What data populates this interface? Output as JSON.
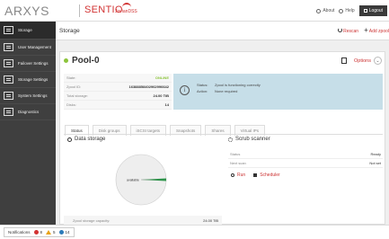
{
  "header": {
    "logo": "ARXYS",
    "app_name": "SENTIO",
    "app_sub": "JovianDSS",
    "about": "About",
    "help": "Help",
    "logout": "Logout"
  },
  "sidebar": {
    "items": [
      {
        "label": "Storage",
        "active": true
      },
      {
        "label": "User Management"
      },
      {
        "label": "Failover Settings"
      },
      {
        "label": "Storage Settings"
      },
      {
        "label": "System Settings"
      },
      {
        "label": "Diagnostics"
      }
    ]
  },
  "main": {
    "breadcrumb": "Storage",
    "rescan": "Rescan",
    "add_zpool": "Add zpool"
  },
  "pool": {
    "name": "Pool-0",
    "options": "Options",
    "properties": [
      {
        "label": "State:",
        "value": "ONLINE"
      },
      {
        "label": "Zpool ID:",
        "value": "16388858402962996642"
      },
      {
        "label": "Total storage:",
        "value": "24.00 TiB"
      },
      {
        "label": "Disks:",
        "value": "14"
      }
    ],
    "status": {
      "status_label": "Status:",
      "status_value": "Zpool is functioning correctly",
      "action_label": "Action:",
      "action_value": "None required"
    },
    "tabs": [
      "Status",
      "Disk groups",
      "iSCSI targets",
      "Snapshots",
      "Shares",
      "Virtual IPs"
    ],
    "data_storage": {
      "title": "Data storage",
      "pie_label": "available",
      "capacity_label": "Zpool storage capacity:",
      "capacity_value": "24.00 TiB"
    },
    "scrub": {
      "title": "Scrub scanner",
      "rows": [
        {
          "label": "Status",
          "value": "Ready"
        },
        {
          "label": "Next scan",
          "value": "Not set"
        }
      ],
      "run": "Run",
      "scheduler": "Scheduler"
    }
  },
  "footer": {
    "notifications": "Notifications",
    "errors": "8",
    "warnings": "5",
    "info": "14"
  },
  "colors": {
    "online": "#8cc43b",
    "accent": "#d23333",
    "status_box": "#c6dee8",
    "sidebar": "#3f3f3f"
  }
}
